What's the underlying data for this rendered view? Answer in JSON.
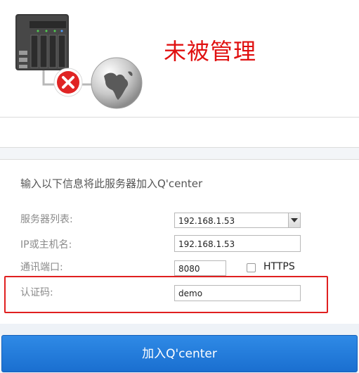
{
  "status": {
    "text": "未被管理"
  },
  "icons": {
    "nas": "nas-device-icon",
    "error": "error-x-icon",
    "globe": "globe-icon"
  },
  "form": {
    "instruction": "输入以下信息将此服务器加入Q'center",
    "server_list": {
      "label": "服务器列表:",
      "value": "192.168.1.53"
    },
    "host": {
      "label": "IP或主机名:",
      "value": "192.168.1.53"
    },
    "port": {
      "label": "通讯端口:",
      "value": "8080"
    },
    "https": {
      "label": "HTTPS",
      "checked": false
    },
    "auth_code": {
      "label": "认证码:",
      "value": "demo"
    }
  },
  "join_button": {
    "label": "加入Q'center"
  },
  "colors": {
    "status_red": "#e01010",
    "button_blue": "#1f78d8",
    "highlight_red": "#e02020"
  }
}
